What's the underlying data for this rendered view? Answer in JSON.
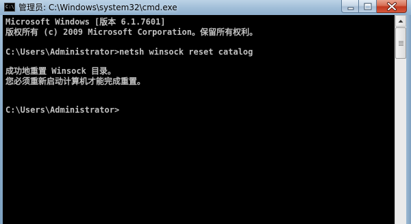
{
  "window": {
    "icon_text": "C:\\",
    "title": "管理员: C:\\Windows\\system32\\cmd.exe",
    "icon": "cmd-icon",
    "controls": {
      "minimize_icon": "minimize-icon",
      "maximize_icon": "maximize-icon",
      "close_icon": "close-icon"
    }
  },
  "console": {
    "lines": [
      "Microsoft Windows [版本 6.1.7601]",
      "版权所有 (c) 2009 Microsoft Corporation。保留所有权利。",
      "",
      "C:\\Users\\Administrator>netsh winsock reset catalog",
      "",
      "成功地重置 Winsock 目录。",
      "您必须重新启动计算机才能完成重置。",
      "",
      "",
      "C:\\Users\\Administrator>"
    ],
    "text_color": "#c0c0c0",
    "background": "#000000"
  },
  "scrollbar": {
    "up_icon": "scroll-up-arrow-icon"
  }
}
